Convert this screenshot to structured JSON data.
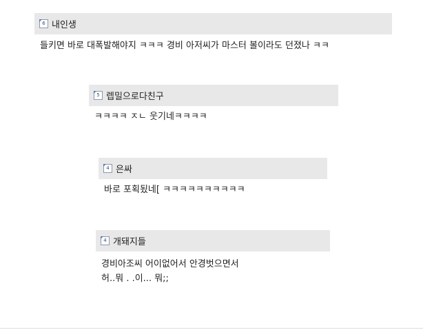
{
  "comments": [
    {
      "level": "6",
      "nickname": "내인생",
      "body": "들키면 바로 대폭발해야지 ㅋㅋㅋ 경비 아저씨가 마스터 볼이라도 던졌나 ㅋㅋ"
    },
    {
      "level": "5",
      "nickname": "렙밀으로다친구",
      "body": "ㅋㅋㅋㅋ ㅈㄴ 웃기네ㅋㅋㅋㅋ"
    },
    {
      "level": "4",
      "nickname": "은싸",
      "body": "바로 포획됬네[ ㅋㅋㅋㅋㅋㅋㅋㅋㅋㅋ"
    },
    {
      "level": "4",
      "nickname": "개돼지들",
      "body": "경비아조씨 어이없어서 안경벗으면서\n허..뭐 . .이... 뭐;;"
    }
  ]
}
